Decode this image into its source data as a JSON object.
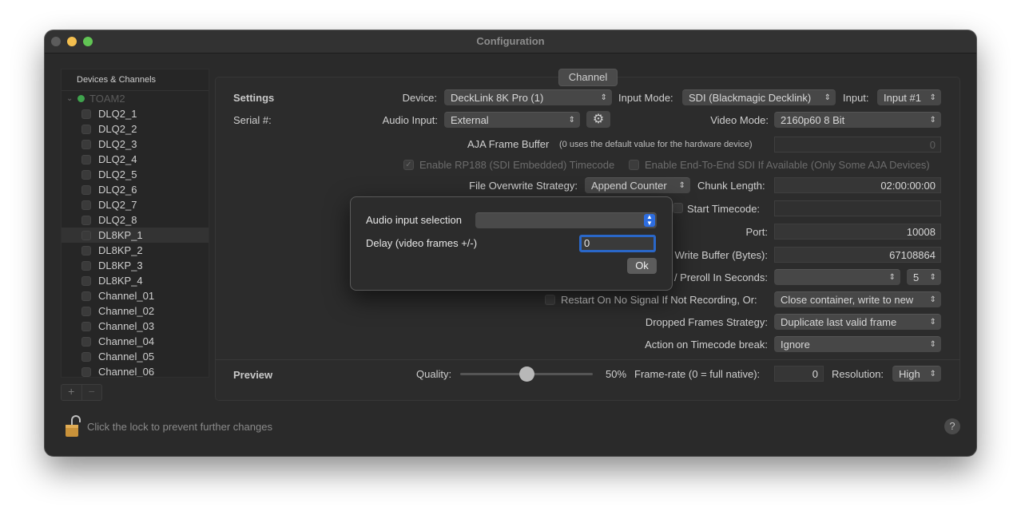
{
  "window": {
    "title": "Configuration"
  },
  "sidebar": {
    "header": "Devices & Channels",
    "root": "TOAM2",
    "items": [
      {
        "label": "DLQ2_1"
      },
      {
        "label": "DLQ2_2"
      },
      {
        "label": "DLQ2_3"
      },
      {
        "label": "DLQ2_4"
      },
      {
        "label": "DLQ2_5"
      },
      {
        "label": "DLQ2_6"
      },
      {
        "label": "DLQ2_7"
      },
      {
        "label": "DLQ2_8"
      },
      {
        "label": "DL8KP_1"
      },
      {
        "label": "DL8KP_2"
      },
      {
        "label": "DL8KP_3"
      },
      {
        "label": "DL8KP_4"
      },
      {
        "label": "Channel_01"
      },
      {
        "label": "Channel_02"
      },
      {
        "label": "Channel_03"
      },
      {
        "label": "Channel_04"
      },
      {
        "label": "Channel_05"
      },
      {
        "label": "Channel_06"
      }
    ],
    "add_label": "+",
    "remove_label": "−"
  },
  "channel": {
    "tab_label": "Channel",
    "settings_title": "Settings",
    "device_label": "Device:",
    "device_value": "DeckLink 8K Pro (1)",
    "input_mode_label": "Input Mode:",
    "input_mode_value": "SDI (Blackmagic Decklink)",
    "input_label": "Input:",
    "input_value": "Input #1",
    "serial_label": "Serial #:",
    "audio_input_label": "Audio Input:",
    "audio_input_value": "External",
    "video_mode_label": "Video Mode:",
    "video_mode_value": "2160p60 8 Bit",
    "aja_label": "AJA Frame Buffer",
    "aja_hint": "(0 uses the default value for the hardware device)",
    "aja_value": "0",
    "rp188_label": "Enable RP188 (SDI Embedded) Timecode",
    "end_to_end_label": "Enable End-To-End SDI If Available (Only Some AJA Devices)",
    "overwrite_label": "File Overwrite Strategy:",
    "overwrite_value": "Append Counter",
    "chunk_label": "Chunk Length:",
    "chunk_value": "02:00:00:00",
    "start_tc_label": "Start Timecode:",
    "port_label": "Port:",
    "port_value": "10008",
    "write_buffer_label": "Write Buffer (Bytes):",
    "write_buffer_value": "67108864",
    "preroll_label": "/ Preroll In Seconds:",
    "preroll_value": "5",
    "restart_label": "Restart On No Signal If Not Recording, Or:",
    "restart_value": "Close container, write to new",
    "dropped_label": "Dropped Frames Strategy:",
    "dropped_value": "Duplicate last valid frame",
    "tc_break_label": "Action on Timecode break:",
    "tc_break_value": "Ignore"
  },
  "preview": {
    "title": "Preview",
    "quality_label": "Quality:",
    "quality_value": "50%",
    "quality_fraction": 0.5,
    "framerate_label": "Frame-rate (0 = full native):",
    "framerate_value": "0",
    "resolution_label": "Resolution:",
    "resolution_value": "High"
  },
  "footer": {
    "lock_text": "Click the lock to prevent further changes",
    "help_label": "?"
  },
  "dialog": {
    "audio_label": "Audio input selection",
    "audio_value": "",
    "delay_label": "Delay (video frames +/-)",
    "delay_value": "0",
    "ok_label": "Ok"
  }
}
